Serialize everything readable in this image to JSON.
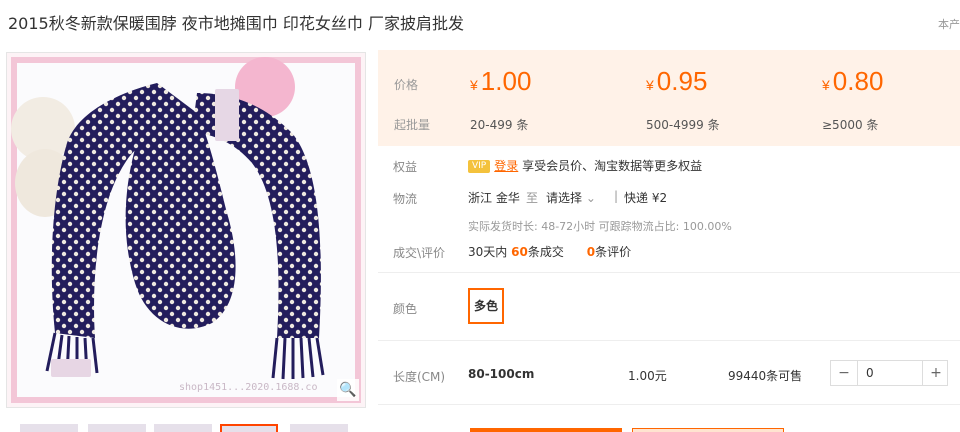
{
  "title": "2015秋冬新款保暖围脖 夜市地摊围巾 印花女丝巾 厂家披肩批发",
  "corner_text": "本产",
  "image": {
    "watermark": "shop1451...2020.1688.co",
    "zoom_icon": "search-icon"
  },
  "price_block": {
    "price_label": "价格",
    "qty_label": "起批量",
    "currency": "¥",
    "tiers": [
      {
        "price": "1.00",
        "qty": "20-499 条"
      },
      {
        "price": "0.95",
        "qty": "500-4999 条"
      },
      {
        "price": "0.80",
        "qty": "≥5000 条"
      }
    ]
  },
  "benefits": {
    "label": "权益",
    "vip_badge": "VIP",
    "login": "登录",
    "text": "享受会员价、淘宝数据等更多权益"
  },
  "logistics": {
    "label": "物流",
    "from": "浙江 金华",
    "to_word": "至",
    "select": "请选择",
    "express": "快递 ¥2",
    "detail": "实际发货时长: 48-72小时   可跟踪物流占比: 100.00%"
  },
  "deals": {
    "label": "成交\\评价",
    "prefix": "30天内",
    "count": "60",
    "count_suffix": "条成交",
    "reviews": "0",
    "reviews_suffix": "条评价"
  },
  "color": {
    "label": "颜色",
    "option": "多色"
  },
  "length_row": {
    "label": "长度(CM)",
    "size": "80-100cm",
    "price": "1.00元",
    "stock": "99440条可售",
    "minus": "−",
    "plus": "+",
    "quantity": "0"
  },
  "colors": {
    "accent": "#ff6600",
    "price_bg": "#fff2e8",
    "scarf": "#231d5c"
  }
}
